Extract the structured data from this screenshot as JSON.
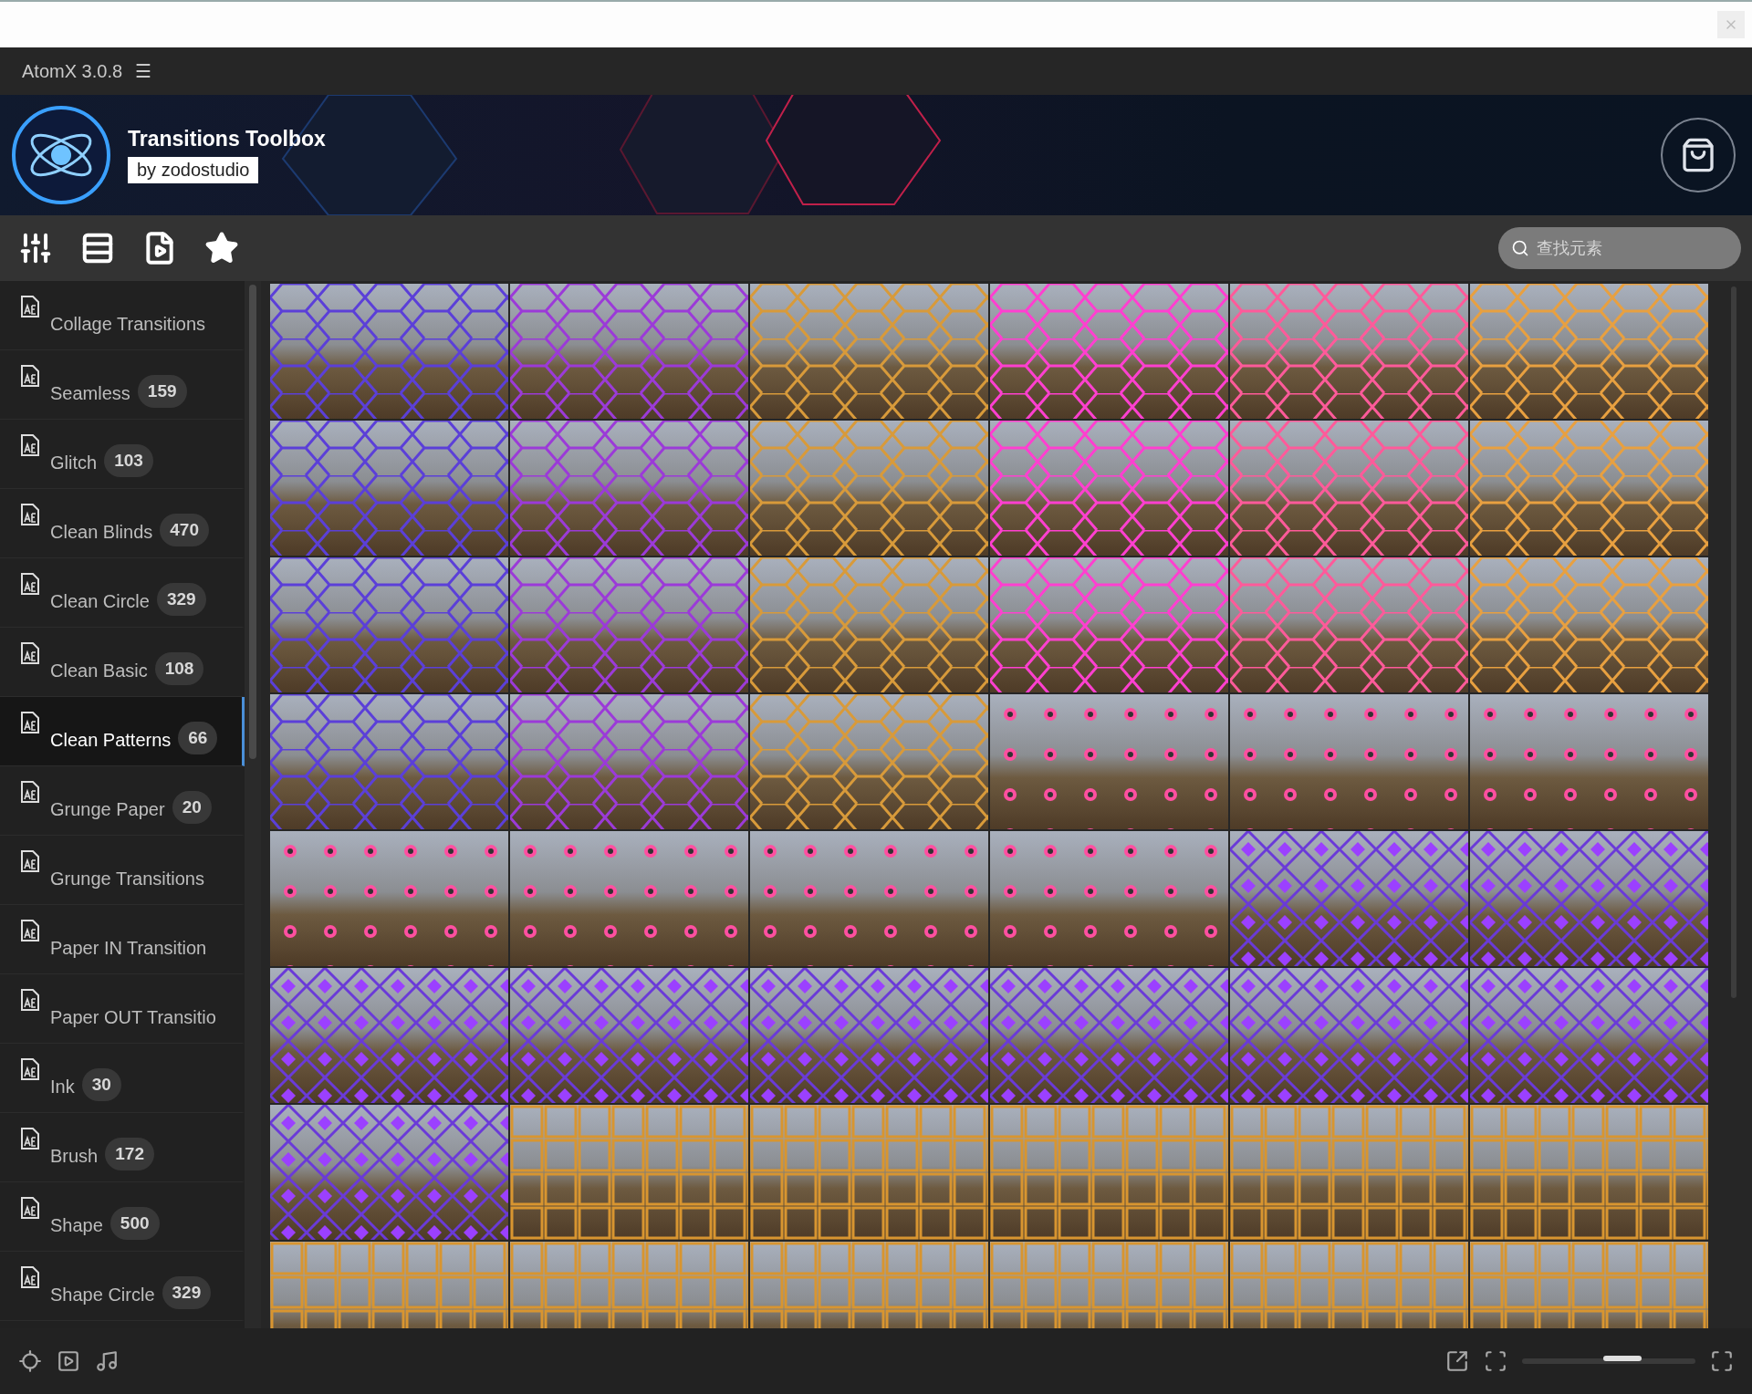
{
  "app_bar": {
    "title": "AtomX 3.0.8",
    "menu_glyph": "☰"
  },
  "banner": {
    "title": "Transitions Toolbox",
    "subtitle": "by zodostudio"
  },
  "search": {
    "placeholder": "查找元素"
  },
  "sidebar": {
    "items": [
      {
        "label": "Collage Transitions",
        "selected": false
      },
      {
        "label": "Seamless",
        "count": "159",
        "selected": false
      },
      {
        "label": "Glitch",
        "count": "103",
        "selected": false
      },
      {
        "label": "Clean Blinds",
        "count": "470",
        "selected": false
      },
      {
        "label": "Clean Circle",
        "count": "329",
        "selected": false
      },
      {
        "label": "Clean Basic",
        "count": "108",
        "selected": false
      },
      {
        "label": "Clean Patterns",
        "count": "66",
        "selected": true
      },
      {
        "label": "Grunge Paper",
        "count": "20",
        "selected": false
      },
      {
        "label": "Grunge Transitions",
        "selected": false
      },
      {
        "label": "Paper IN Transition",
        "selected": false
      },
      {
        "label": "Paper OUT Transitio",
        "selected": false
      },
      {
        "label": "Ink",
        "count": "30",
        "selected": false
      },
      {
        "label": "Brush",
        "count": "172",
        "selected": false
      },
      {
        "label": "Shape",
        "count": "500",
        "selected": false
      },
      {
        "label": "Shape Circle",
        "count": "329",
        "selected": false
      }
    ]
  },
  "thumbnails": [
    {
      "kind": "hex"
    },
    {
      "kind": "hex"
    },
    {
      "kind": "hex"
    },
    {
      "kind": "hex"
    },
    {
      "kind": "hex"
    },
    {
      "kind": "hex"
    },
    {
      "kind": "hex"
    },
    {
      "kind": "hex"
    },
    {
      "kind": "hex"
    },
    {
      "kind": "hex"
    },
    {
      "kind": "hex"
    },
    {
      "kind": "hex"
    },
    {
      "kind": "hex"
    },
    {
      "kind": "hex"
    },
    {
      "kind": "hex"
    },
    {
      "kind": "hex"
    },
    {
      "kind": "hex"
    },
    {
      "kind": "hex"
    },
    {
      "kind": "hex"
    },
    {
      "kind": "hex"
    },
    {
      "kind": "hex"
    },
    {
      "kind": "dots"
    },
    {
      "kind": "dots"
    },
    {
      "kind": "dots"
    },
    {
      "kind": "dots"
    },
    {
      "kind": "dots"
    },
    {
      "kind": "dots"
    },
    {
      "kind": "dots"
    },
    {
      "kind": "diamond"
    },
    {
      "kind": "diamond"
    },
    {
      "kind": "diamond"
    },
    {
      "kind": "diamond"
    },
    {
      "kind": "diamond"
    },
    {
      "kind": "diamond"
    },
    {
      "kind": "diamond"
    },
    {
      "kind": "diamond"
    },
    {
      "kind": "diamond"
    },
    {
      "kind": "square"
    },
    {
      "kind": "square"
    },
    {
      "kind": "square"
    },
    {
      "kind": "square"
    },
    {
      "kind": "square"
    },
    {
      "kind": "square"
    },
    {
      "kind": "square"
    },
    {
      "kind": "square"
    },
    {
      "kind": "square"
    },
    {
      "kind": "square"
    },
    {
      "kind": "square"
    }
  ],
  "zoom_slider": {
    "level": 0.58
  }
}
